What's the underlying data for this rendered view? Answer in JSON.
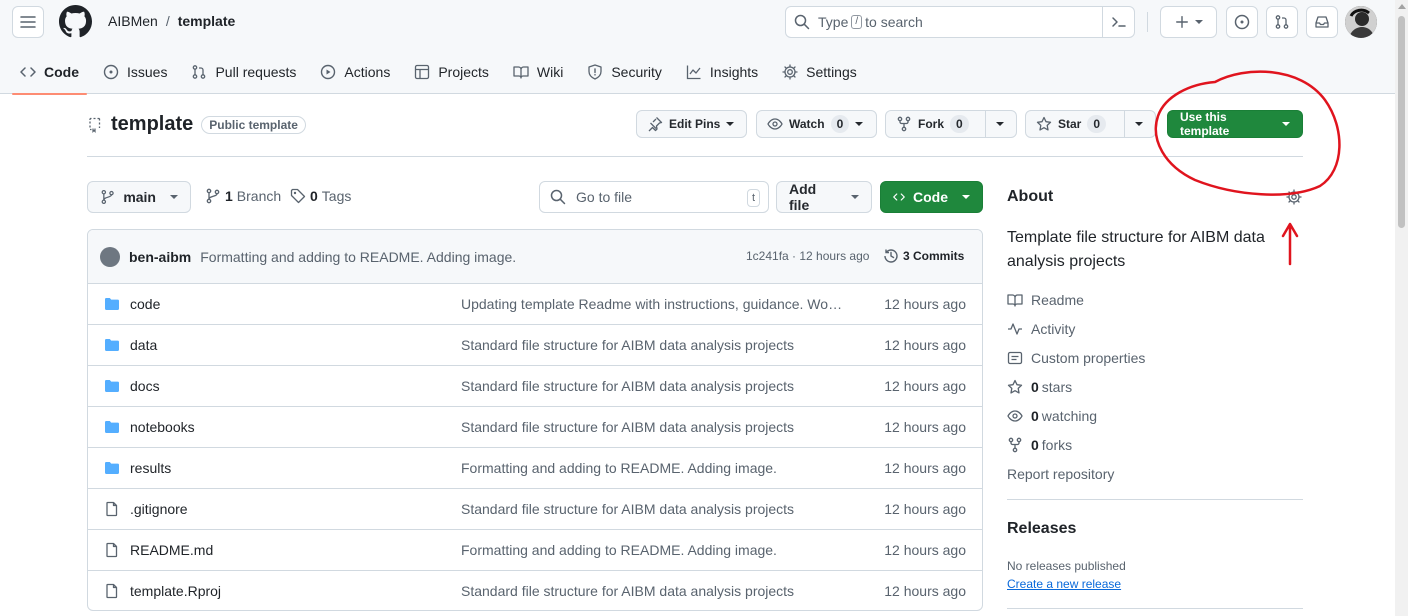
{
  "header": {
    "owner": "AIBMen",
    "separator": "/",
    "repo": "template",
    "search_prefix": "Type",
    "search_key": "/",
    "search_suffix": "to search"
  },
  "tabs": [
    {
      "label": "Code",
      "icon": "code-icon",
      "active": true
    },
    {
      "label": "Issues",
      "icon": "issue-opened-icon"
    },
    {
      "label": "Pull requests",
      "icon": "git-pull-request-icon"
    },
    {
      "label": "Actions",
      "icon": "play-icon"
    },
    {
      "label": "Projects",
      "icon": "table-icon"
    },
    {
      "label": "Wiki",
      "icon": "book-icon"
    },
    {
      "label": "Security",
      "icon": "shield-icon"
    },
    {
      "label": "Insights",
      "icon": "graph-icon"
    },
    {
      "label": "Settings",
      "icon": "gear-icon"
    }
  ],
  "repo_header": {
    "name": "template",
    "visibility": "Public template",
    "edit_pins": "Edit Pins",
    "watch": "Watch",
    "watch_count": "0",
    "fork": "Fork",
    "fork_count": "0",
    "star": "Star",
    "star_count": "0",
    "use_template": "Use this template"
  },
  "branch_bar": {
    "branch": "main",
    "branch_count": "1",
    "branch_label": "Branch",
    "tag_count": "0",
    "tag_label": "Tags",
    "goto_placeholder": "Go to file",
    "goto_key": "t",
    "add_file": "Add file",
    "code": "Code"
  },
  "latest_commit": {
    "author": "ben-aibm",
    "message": "Formatting and adding to README. Adding image.",
    "sha_time": "1c241fa · 12 hours ago",
    "commits": "3 Commits"
  },
  "files": [
    {
      "name": "code",
      "type": "folder",
      "message": "Updating template Readme with instructions, guidance. Workflow and tips for using the template",
      "time": "12 hours ago"
    },
    {
      "name": "data",
      "type": "folder",
      "message": "Standard file structure for AIBM data analysis projects",
      "time": "12 hours ago"
    },
    {
      "name": "docs",
      "type": "folder",
      "message": "Standard file structure for AIBM data analysis projects",
      "time": "12 hours ago"
    },
    {
      "name": "notebooks",
      "type": "folder",
      "message": "Standard file structure for AIBM data analysis projects",
      "time": "12 hours ago"
    },
    {
      "name": "results",
      "type": "folder",
      "message": "Formatting and adding to README. Adding image.",
      "time": "12 hours ago"
    },
    {
      "name": ".gitignore",
      "type": "file",
      "message": "Standard file structure for AIBM data analysis projects",
      "time": "12 hours ago"
    },
    {
      "name": "README.md",
      "type": "file",
      "message": "Formatting and adding to README. Adding image.",
      "time": "12 hours ago"
    },
    {
      "name": "template.Rproj",
      "type": "file",
      "message": "Standard file structure for AIBM data analysis projects",
      "time": "12 hours ago"
    }
  ],
  "about": {
    "heading": "About",
    "description": "Template file structure for AIBM data analysis projects",
    "readme": "Readme",
    "activity": "Activity",
    "custom_properties": "Custom properties",
    "stars_count": "0",
    "stars_label": "stars",
    "watching_count": "0",
    "watching_label": "watching",
    "forks_count": "0",
    "forks_label": "forks",
    "report": "Report repository"
  },
  "releases": {
    "heading": "Releases",
    "none": "No releases published",
    "create": "Create a new release"
  },
  "colors": {
    "accent_green": "#1f883d",
    "folder_blue": "#54aeff",
    "tab_underline": "#fd8c73",
    "annotation_red": "#e0141e",
    "link_blue": "#0969da"
  }
}
